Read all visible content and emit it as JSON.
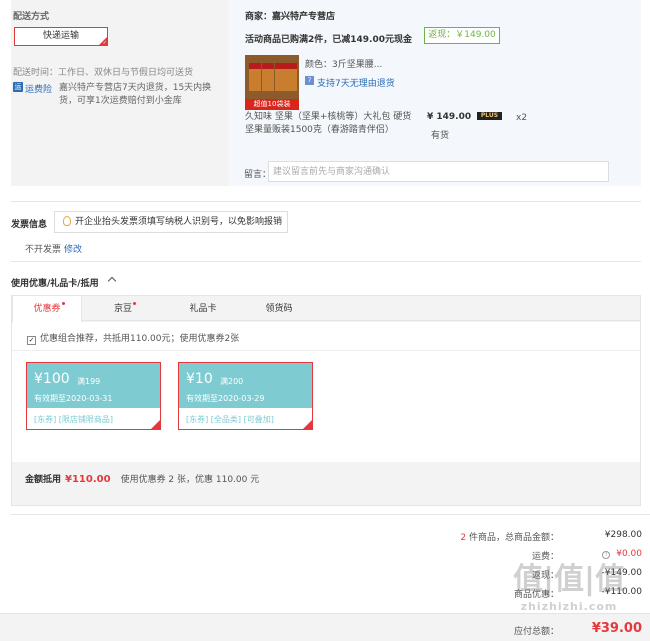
{
  "shipping": {
    "title": "配送方式",
    "method_label": "快递运输",
    "time_text": "配送时间：工作日、双休日与节假日均可送货",
    "insurance_icon": "运",
    "insurance_label": "运费险",
    "insurance_desc": "嘉兴特产专营店7天内退货，15天内换货，可享1次运费赔付到小金库"
  },
  "merchant": {
    "name_text": "商家：嘉兴特产专营店",
    "promo_text": "活动商品已购满2件，已减149.00元现金",
    "cashback_label": "返现：￥149.00"
  },
  "product": {
    "image_banner": "超值10袋装",
    "color_text": "颜色：3斤坚果腰...",
    "return_policy": "支持7天无理由退货",
    "name": "久知味 坚果（坚果+核桃等）大礼包 硬货坚果量贩装1500克（春游踏青伴侣）",
    "price": "¥ 149.00",
    "plus_badge": "PLUS",
    "stock": "有货",
    "quantity": "x2"
  },
  "message": {
    "label": "留言：",
    "placeholder": "建议留言前先与商家沟通确认"
  },
  "invoice": {
    "title": "发票信息",
    "tip": "开企业抬头发票须填写纳税人识别号，以免影响报销",
    "status": "不开发票",
    "edit_link": "修改"
  },
  "coupons": {
    "title": "使用优惠/礼品卡/抵用",
    "tabs": [
      {
        "label": "优惠券",
        "active": true
      },
      {
        "label": "京豆",
        "active": false
      },
      {
        "label": "礼品卡",
        "active": false
      },
      {
        "label": "领货码",
        "active": false
      }
    ],
    "combo_text": "优惠组合推荐，共抵用110.00元；使用优惠券2张",
    "items": [
      {
        "amount": "¥100",
        "condition": "满199",
        "expiry": "有效期至2020-03-31",
        "tags": "[东券] [限店铺限商品]"
      },
      {
        "amount": "¥10",
        "condition": "满200",
        "expiry": "有效期至2020-03-29",
        "tags": "[东券] [全品类] [可叠加]"
      }
    ],
    "deduct_label": "金额抵用",
    "deduct_value": "¥110.00",
    "deduct_note": "使用优惠券 2 张，优惠 110.00 元"
  },
  "summary": {
    "count": "2",
    "count_suffix": " 件商品，总商品金额：",
    "goods_total": "¥298.00",
    "freight_label": "运费：",
    "freight_value": "¥0.00",
    "row3_label": "返现：",
    "row3_value": "-¥149.00",
    "row4_label": "商品优惠：",
    "row4_value": "-¥110.00",
    "total_label": "应付总额：",
    "total_value": "¥39.00"
  },
  "watermark": {
    "main": "值|值|值",
    "url": "zhizhizhi.com"
  },
  "colors": {
    "accent_red": "#e4393c",
    "teal": "#7ecbd1",
    "green": "#71b247",
    "link_blue": "#2a6bb6"
  }
}
